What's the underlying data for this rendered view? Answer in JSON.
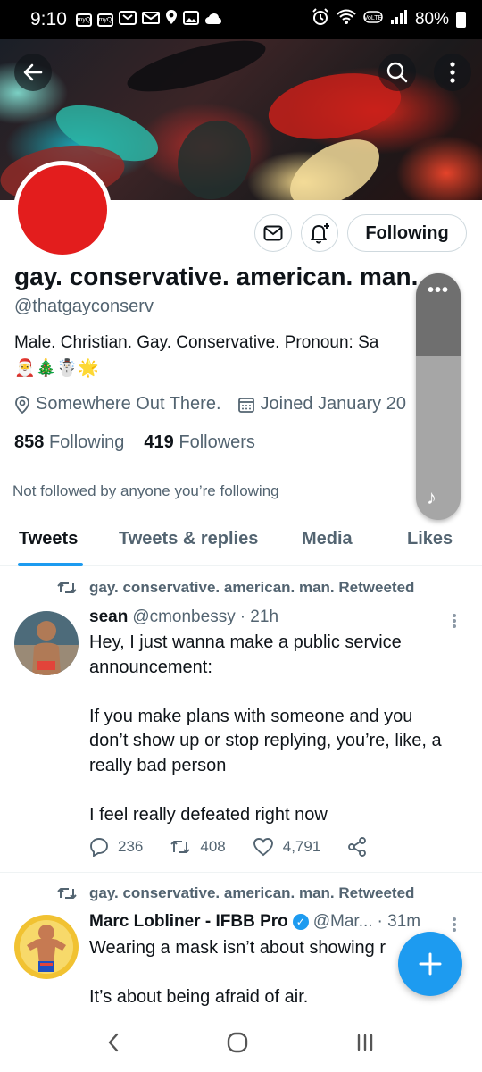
{
  "status_bar": {
    "time": "9:10",
    "left_badges": [
      "myQ",
      "myQ"
    ],
    "battery": "80%"
  },
  "profile": {
    "display_name": "gay. conservative. american. man.",
    "handle": "@thatgayconserv",
    "bio": "Male. Christian. Gay. Conservative. Pronoun: Sa",
    "bio_emoji": "🎅🎄☃️🌟",
    "location": "Somewhere Out There.",
    "joined": "Joined January 20",
    "following_count": "858",
    "following_label": "Following",
    "followers_count": "419",
    "followers_label": "Followers",
    "not_followed_text": "Not followed by anyone you’re following",
    "following_button": "Following",
    "avatar_color": "#e31d1d"
  },
  "tabs": [
    "Tweets",
    "Tweets & replies",
    "Media",
    "Likes"
  ],
  "tweets": [
    {
      "retweet_label": "gay. conservative. american. man. Retweeted",
      "name": "sean",
      "handle": "@cmonbessy",
      "time": "· 21h",
      "lines": [
        "Hey, I just wanna make a public service",
        "announcement:",
        "",
        "If you make plans with someone and you",
        "don’t show up or stop replying, you’re, like, a",
        "really bad person",
        "",
        "I feel really defeated right now"
      ],
      "replies": "236",
      "retweets": "408",
      "likes": "4,791"
    },
    {
      "retweet_label": "gay. conservative. american. man. Retweeted",
      "name": "Marc Lobliner - IFBB Pro",
      "handle": "@Mar...",
      "time": "· 31m",
      "lines": [
        "Wearing a mask isn’t about showing r",
        "",
        "It’s about being afraid of air."
      ]
    }
  ],
  "colors": {
    "accent": "#1d9bf0",
    "text_primary": "#0f1419",
    "text_secondary": "#536471"
  }
}
